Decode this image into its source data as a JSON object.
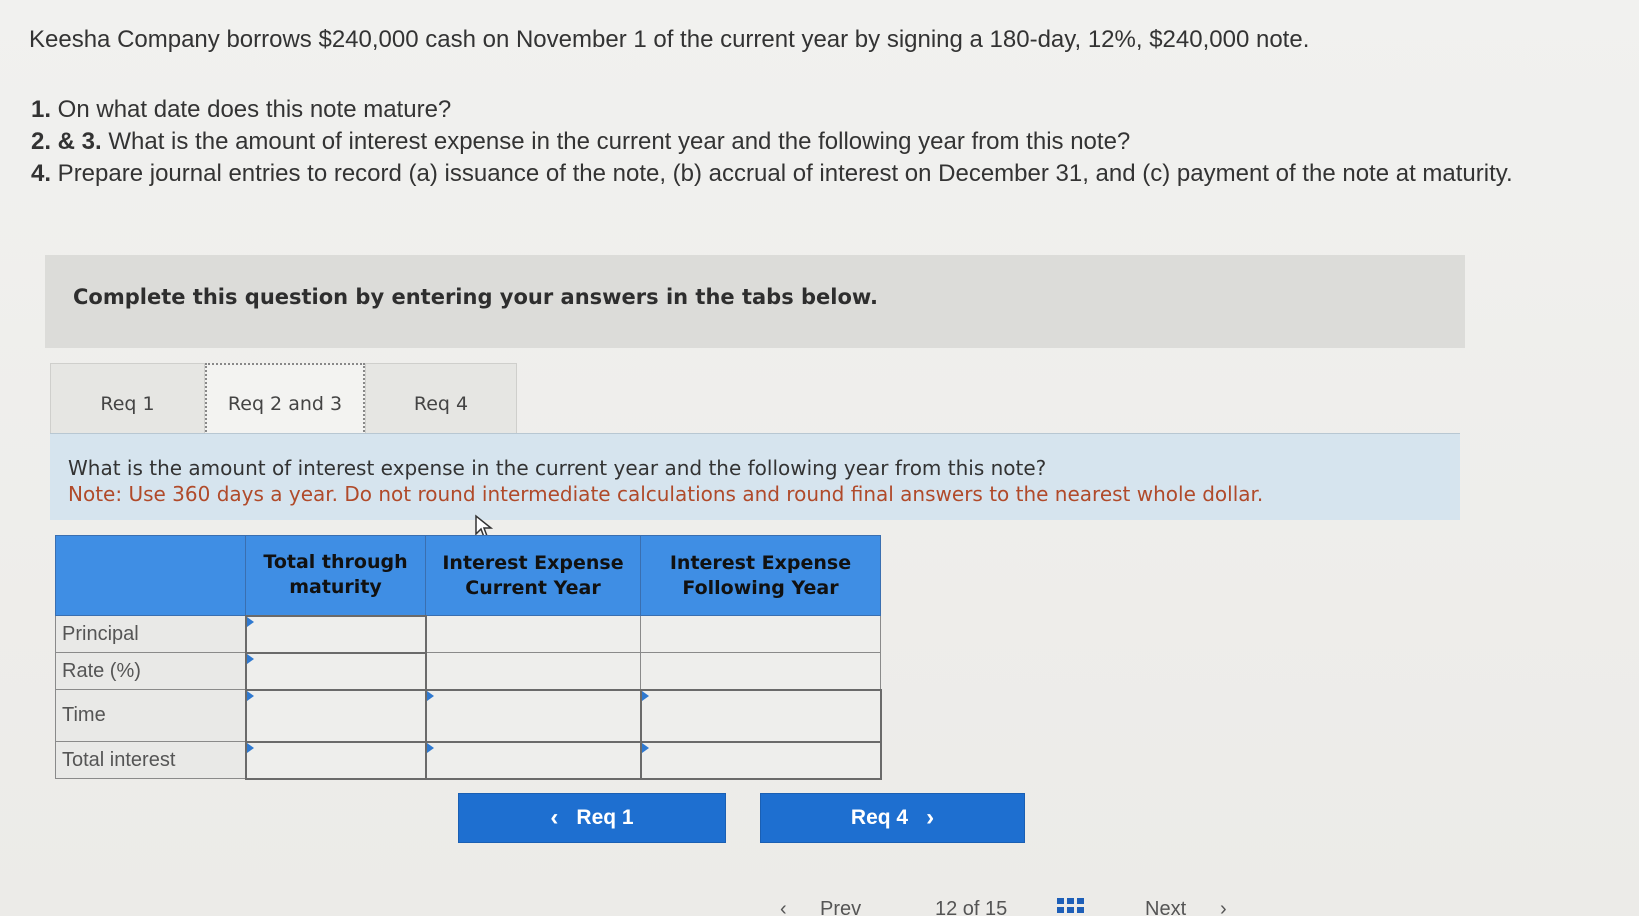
{
  "problem": {
    "intro": "Keesha Company borrows $240,000 cash on November 1 of the current year by signing a 180-day, 12%, $240,000 note.",
    "questions": [
      {
        "num": "1.",
        "text": " On what date does this note mature?"
      },
      {
        "num": "2. & 3.",
        "text": " What is the amount of interest expense in the current year and the following year from this note?"
      },
      {
        "num": "4.",
        "text": " Prepare journal entries to record (a) issuance of the note, (b) accrual of interest on December 31, and (c) payment of the note at maturity."
      }
    ]
  },
  "banner": {
    "text": "Complete this question by entering your answers in the tabs below."
  },
  "tabs": [
    {
      "label": "Req 1",
      "active": false
    },
    {
      "label": "Req 2 and 3",
      "active": true
    },
    {
      "label": "Req 4",
      "active": false
    }
  ],
  "instructions": {
    "question": "What is the amount of interest expense in the current year and the following year from this note?",
    "note": "Note: Use 360 days a year. Do not round intermediate calculations and round final answers to the nearest whole dollar."
  },
  "table": {
    "headers": [
      "",
      "Total through maturity",
      "Interest Expense Current Year",
      "Interest Expense Following Year"
    ],
    "header_lines": [
      [
        "",
        ""
      ],
      [
        "Total through",
        "maturity"
      ],
      [
        "Interest Expense",
        "Current Year"
      ],
      [
        "Interest Expense",
        "Following Year"
      ]
    ],
    "rows": [
      {
        "label": "Principal",
        "values": [
          "",
          "",
          ""
        ]
      },
      {
        "label": "Rate (%)",
        "values": [
          "",
          "",
          ""
        ]
      },
      {
        "label": "Time",
        "values": [
          "",
          "",
          ""
        ]
      },
      {
        "label": "Total interest",
        "values": [
          "",
          "",
          ""
        ]
      }
    ]
  },
  "navigation": {
    "prev_label": "Req 1",
    "next_label": "Req 4"
  },
  "pager": {
    "prev": "Prev",
    "position": "12 of 15",
    "next": "Next"
  },
  "colors": {
    "header_blue": "#3f8ee4",
    "button_blue": "#1e6fd0",
    "note_red": "#b04a2a",
    "instructions_bg": "#d6e4ee"
  }
}
